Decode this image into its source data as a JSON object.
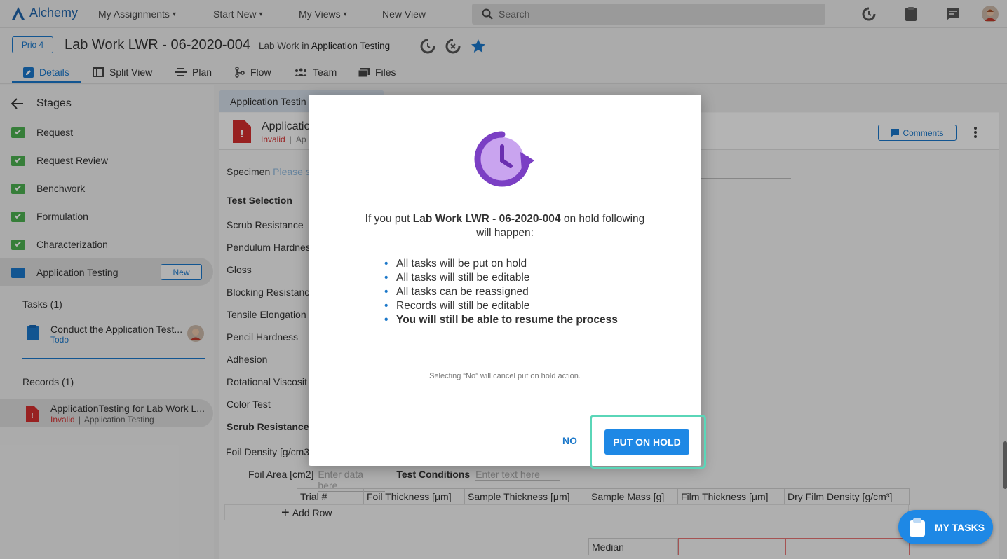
{
  "app": {
    "name": "Alchemy"
  },
  "nav": {
    "my_assignments": "My Assignments",
    "start_new": "Start New",
    "my_views": "My Views",
    "new_view": "New View",
    "search_placeholder": "Search"
  },
  "header": {
    "priority": "Prio 4",
    "title": "Lab Work LWR - 06-2020-004",
    "subtitle_prefix": "Lab Work in",
    "subtitle_strong": "Application Testing"
  },
  "tabs": [
    "Details",
    "Split View",
    "Plan",
    "Flow",
    "Team",
    "Files"
  ],
  "sidebar": {
    "heading": "Stages",
    "stages": [
      "Request",
      "Request Review",
      "Benchwork",
      "Formulation",
      "Characterization",
      "Application Testing"
    ],
    "new_badge": "New",
    "tasks_heading": "Tasks (1)",
    "task_title": "Conduct the Application Test...",
    "task_status": "Todo",
    "records_heading": "Records (1)",
    "record_title": "ApplicationTesting for Lab Work L...",
    "record_status": "Invalid",
    "record_sep": "|",
    "record_stage": "Application Testing"
  },
  "content": {
    "tab_label": "Application Testin",
    "record_title": "Applicatio",
    "record_status": "Invalid",
    "record_rest": "Ap",
    "comments": "Comments",
    "specimen_label": "Specimen",
    "specimen_placeholder": "Please s",
    "test_selection": "Test Selection",
    "tests": [
      "Scrub Resistance",
      "Pendulum Hardnes",
      "Gloss",
      "Blocking Resistanc",
      "Tensile Elongation",
      "Pencil Hardness",
      "Adhesion",
      "Rotational Viscosit",
      "Color Test"
    ],
    "scrub_heading": "Scrub Resistance",
    "foil_density": "Foil Density [g/cm3",
    "foil_area": "Foil Area [cm2]",
    "foil_area_placeholder": "Enter data here",
    "test_conditions": "Test Conditions",
    "test_conditions_placeholder": "Enter text here",
    "table_headers": [
      "Trial #",
      "Foil Thickness [μm]",
      "Sample Thickness [μm]",
      "Sample Mass [g]",
      "Film Thickness [μm]",
      "Dry Film Density [g/cm³]"
    ],
    "add_row": "Add Row",
    "median": "Median"
  },
  "modal": {
    "text_prefix": "If you put",
    "text_strong": "Lab Work LWR - 06-2020-004",
    "text_suffix": "on hold following will happen:",
    "items": [
      "All tasks will be put on hold",
      "All tasks will still be editable",
      "All tasks can be reassigned",
      "Records will still be editable"
    ],
    "item_strong": "You will still be able to resume the process",
    "note": "Selecting “No” will cancel put on hold action.",
    "no": "NO",
    "put_on_hold": "PUT ON HOLD"
  },
  "my_tasks": "MY TASKS",
  "colors": {
    "accent": "#1e88e5",
    "brand": "#1f63a8",
    "stage_done": "#4caf50",
    "hold_icon": "#7b3fc4",
    "invalid": "#d32f2f",
    "highlight": "#5ad6b8"
  }
}
